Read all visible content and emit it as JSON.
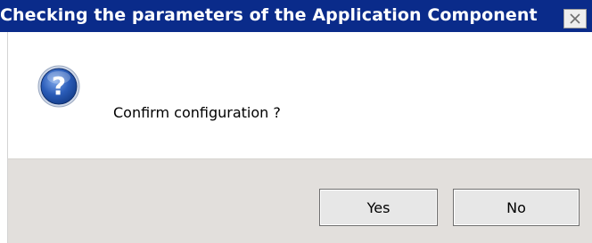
{
  "window": {
    "title": "Checking the parameters of the Application Component",
    "close_icon": "close-icon"
  },
  "message": {
    "icon": "question-icon",
    "text": "Confirm configuration ?"
  },
  "buttons": {
    "yes_label": "Yes",
    "no_label": "No"
  },
  "colors": {
    "titlebar": "#0a2b8a",
    "title_text": "#ffffff",
    "content_bg": "#ffffff",
    "footer_bg": "#e2dfdc",
    "icon_blue": "#1e4fa6"
  }
}
